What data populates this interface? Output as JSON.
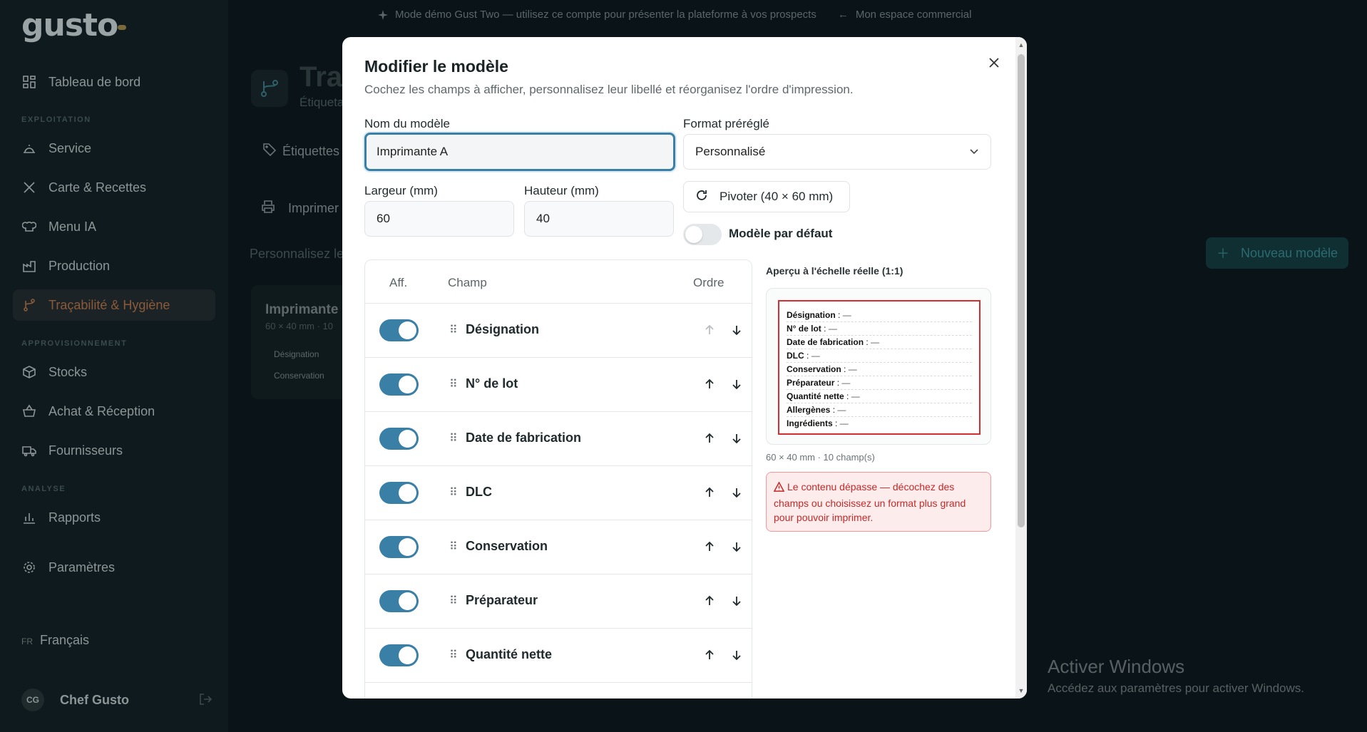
{
  "banner": {
    "demo_text": "Mode démo Gust Two — utilisez ce compte pour présenter la plateforme à vos prospects",
    "back_link": "Mon espace commercial"
  },
  "sidebar": {
    "logo": "gusto",
    "sections": {
      "exploitation": "EXPLOITATION",
      "approvisionnement": "APPROVISIONNEMENT",
      "analyse": "ANALYSE"
    },
    "items": [
      {
        "label": "Tableau de bord",
        "icon": "dashboard-icon"
      },
      {
        "label": "Service",
        "icon": "cloche-icon"
      },
      {
        "label": "Carte & Recettes",
        "icon": "utensils-icon"
      },
      {
        "label": "Menu IA",
        "icon": "chef-hat-icon"
      },
      {
        "label": "Production",
        "icon": "factory-icon"
      },
      {
        "label": "Traçabilité & Hygiène",
        "icon": "branch-icon"
      },
      {
        "label": "Stocks",
        "icon": "box-icon"
      },
      {
        "label": "Achat & Réception",
        "icon": "basket-icon"
      },
      {
        "label": "Fournisseurs",
        "icon": "truck-icon"
      },
      {
        "label": "Rapports",
        "icon": "bar-chart-icon"
      },
      {
        "label": "Paramètres",
        "icon": "gear-icon"
      }
    ],
    "language_code": "FR",
    "language": "Français",
    "user_initials": "CG",
    "user_name": "Chef Gusto"
  },
  "background": {
    "page_title": "Tra",
    "page_subtitle": "Étiqueta",
    "tab_label": "Étiquettes",
    "print_label": "Imprimer",
    "hint": "Personnalisez le",
    "card_title": "Imprimante",
    "card_sub": "60 × 40 mm · 10",
    "card_chip_1": "Désignation",
    "card_chip_2": "Conservation",
    "new_model_button": "Nouveau modèle"
  },
  "modal": {
    "title": "Modifier le modèle",
    "description": "Cochez les champs à afficher, personnalisez leur libellé et réorganisez l'ordre d'impression.",
    "name_label": "Nom du modèle",
    "name_value": "Imprimante A",
    "format_label": "Format préréglé",
    "format_value": "Personnalisé",
    "width_label": "Largeur (mm)",
    "width_value": "60",
    "height_label": "Hauteur (mm)",
    "height_value": "40",
    "rotate_button": "Pivoter (40 × 60 mm)",
    "default_label": "Modèle par défaut",
    "default_on": false,
    "table": {
      "col_show": "Aff.",
      "col_field": "Champ",
      "col_order": "Ordre",
      "rows": [
        {
          "label": "Désignation",
          "on": true,
          "up_disabled": true
        },
        {
          "label": "N° de lot",
          "on": true,
          "up_disabled": false
        },
        {
          "label": "Date de fabrication",
          "on": true,
          "up_disabled": false
        },
        {
          "label": "DLC",
          "on": true,
          "up_disabled": false
        },
        {
          "label": "Conservation",
          "on": true,
          "up_disabled": false
        },
        {
          "label": "Préparateur",
          "on": true,
          "up_disabled": false
        },
        {
          "label": "Quantité nette",
          "on": true,
          "up_disabled": false
        },
        {
          "label": "",
          "on": true,
          "up_disabled": false
        }
      ]
    },
    "preview": {
      "title": "Aperçu à l'échelle réelle (1:1)",
      "fields": [
        {
          "name": "Désignation",
          "value": "—"
        },
        {
          "name": "N° de lot",
          "value": "—"
        },
        {
          "name": "Date de fabrication",
          "value": "—"
        },
        {
          "name": "DLC",
          "value": "—"
        },
        {
          "name": "Conservation",
          "value": "—"
        },
        {
          "name": "Préparateur",
          "value": "—"
        },
        {
          "name": "Quantité nette",
          "value": "—"
        },
        {
          "name": "Allergènes",
          "value": "—"
        },
        {
          "name": "Ingrédients",
          "value": "—"
        }
      ],
      "meta": "60 × 40 mm · 10 champ(s)",
      "alert": "Le contenu dépasse — décochez des champs ou choisissez un format plus grand pour pouvoir imprimer."
    }
  },
  "watermark": {
    "title": "Activer Windows",
    "subtitle": "Accédez aux paramètres pour activer Windows."
  },
  "colors": {
    "toggle_on": "#3a7fa6",
    "alert_red": "#c62828",
    "label_border": "#d32f2f",
    "active_nav": "#8a5a3a"
  }
}
